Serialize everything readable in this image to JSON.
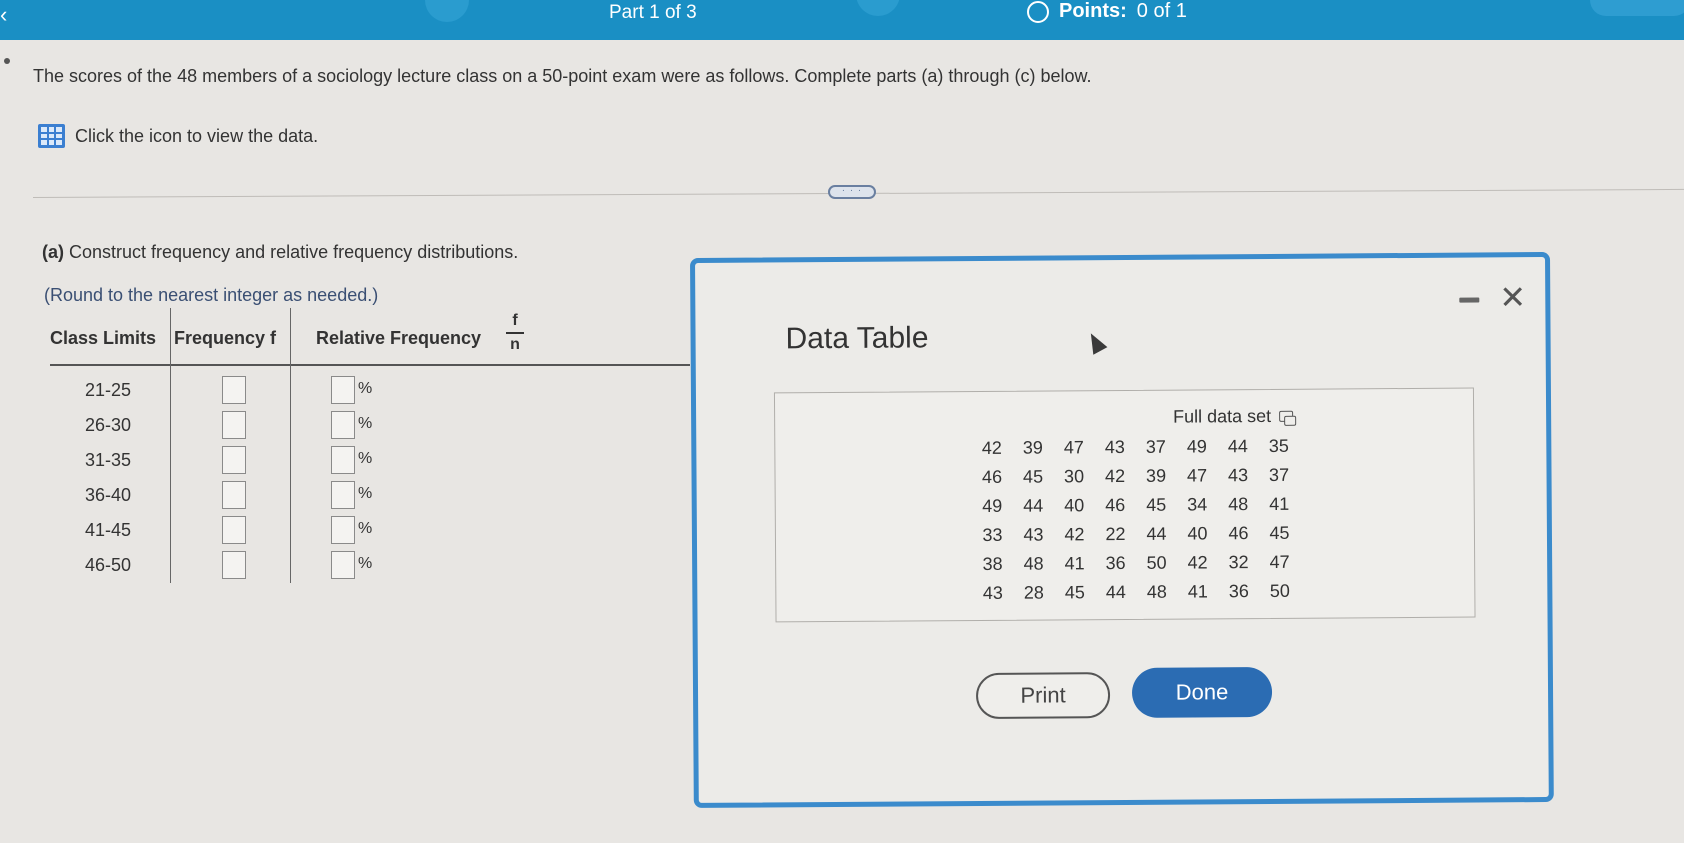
{
  "header": {
    "back_glyph": "‹",
    "part": "Part 1 of 3",
    "points_label": "Points:",
    "points_value": "0 of 1"
  },
  "question": {
    "prompt": "The scores of the 48 members of a sociology lecture class on a 50-point exam were as follows. Complete parts (a) through (c) below.",
    "data_link": "Click the icon to view the data.",
    "expander": "· · ·",
    "part_a_letter": "(a)",
    "part_a_text": " Construct frequency and relative frequency distributions.",
    "round_note": "(Round to the nearest integer as needed.)"
  },
  "table": {
    "headers": {
      "class_limits": "Class Limits",
      "frequency": "Frequency f",
      "relative_frequency": "Relative Frequency",
      "fraction_num": "f",
      "fraction_den": "n"
    },
    "percent": "%",
    "rows": [
      {
        "limits": "21-25"
      },
      {
        "limits": "26-30"
      },
      {
        "limits": "31-35"
      },
      {
        "limits": "36-40"
      },
      {
        "limits": "41-45"
      },
      {
        "limits": "46-50"
      }
    ]
  },
  "modal": {
    "title": "Data Table",
    "close_glyph": "✕",
    "full_data_label": "Full data set",
    "data": [
      [
        42,
        39,
        47,
        43,
        37,
        49,
        44,
        35
      ],
      [
        46,
        45,
        30,
        42,
        39,
        47,
        43,
        37
      ],
      [
        49,
        44,
        40,
        46,
        45,
        34,
        48,
        41
      ],
      [
        33,
        43,
        42,
        22,
        44,
        40,
        46,
        45
      ],
      [
        38,
        48,
        41,
        36,
        50,
        42,
        32,
        47
      ],
      [
        43,
        28,
        45,
        44,
        48,
        41,
        36,
        50
      ]
    ],
    "print_label": "Print",
    "done_label": "Done"
  },
  "colors": {
    "header_blue": "#1a8fc4",
    "modal_border": "#3b8bcc",
    "done_button": "#2b6cb3"
  }
}
